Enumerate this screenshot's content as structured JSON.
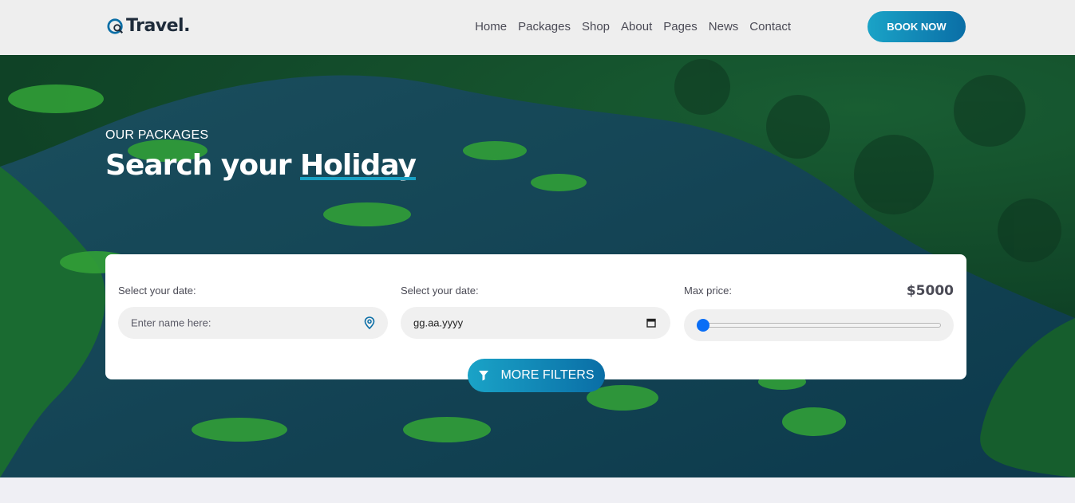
{
  "brand": {
    "name": "Travel.",
    "accent": "#18a0c3"
  },
  "nav": {
    "items": [
      "Home",
      "Packages",
      "Shop",
      "About",
      "Pages",
      "News",
      "Contact"
    ],
    "book_label": "BOOK NOW"
  },
  "hero": {
    "eyebrow": "OUR PACKAGES",
    "title_prefix": "Search your ",
    "title_highlight": "Holiday"
  },
  "search": {
    "field1": {
      "label": "Select your date:",
      "placeholder": "Enter name here:",
      "icon": "map-pin-icon"
    },
    "field2": {
      "label": "Select your date:",
      "value": "gg.aa.yyyy",
      "icon": "calendar-icon"
    },
    "price": {
      "label": "Max price:",
      "value": "$5000",
      "slider_fraction": 0.0
    },
    "filters_label": "MORE FILTERS",
    "filters_icon": "filter-icon"
  }
}
